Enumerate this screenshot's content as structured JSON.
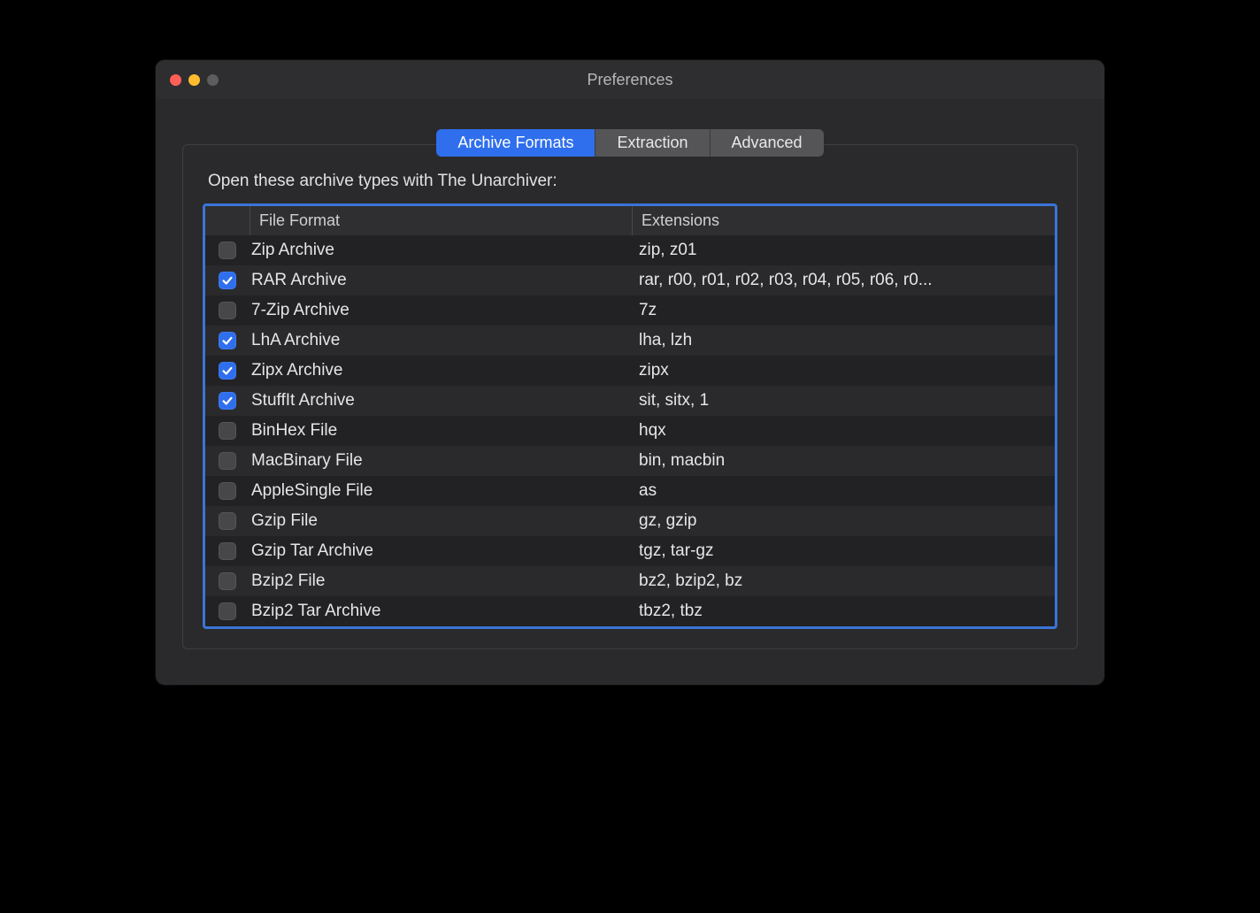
{
  "window": {
    "title": "Preferences"
  },
  "tabs": [
    {
      "label": "Archive Formats",
      "active": true
    },
    {
      "label": "Extraction",
      "active": false
    },
    {
      "label": "Advanced",
      "active": false
    }
  ],
  "group_label": "Open these archive types with The Unarchiver:",
  "columns": {
    "format": "File Format",
    "extensions": "Extensions"
  },
  "rows": [
    {
      "checked": false,
      "format": "Zip Archive",
      "extensions": "zip, z01"
    },
    {
      "checked": true,
      "format": "RAR Archive",
      "extensions": "rar, r00, r01, r02, r03, r04, r05, r06, r0..."
    },
    {
      "checked": false,
      "format": "7-Zip Archive",
      "extensions": "7z"
    },
    {
      "checked": true,
      "format": "LhA Archive",
      "extensions": "lha, lzh"
    },
    {
      "checked": true,
      "format": "Zipx Archive",
      "extensions": "zipx"
    },
    {
      "checked": true,
      "format": "StuffIt Archive",
      "extensions": "sit, sitx, 1"
    },
    {
      "checked": false,
      "format": "BinHex File",
      "extensions": "hqx"
    },
    {
      "checked": false,
      "format": "MacBinary File",
      "extensions": "bin, macbin"
    },
    {
      "checked": false,
      "format": "AppleSingle File",
      "extensions": "as"
    },
    {
      "checked": false,
      "format": "Gzip File",
      "extensions": "gz, gzip"
    },
    {
      "checked": false,
      "format": "Gzip Tar Archive",
      "extensions": "tgz, tar-gz"
    },
    {
      "checked": false,
      "format": "Bzip2 File",
      "extensions": "bz2, bzip2, bz"
    },
    {
      "checked": false,
      "format": "Bzip2 Tar Archive",
      "extensions": "tbz2, tbz"
    }
  ]
}
